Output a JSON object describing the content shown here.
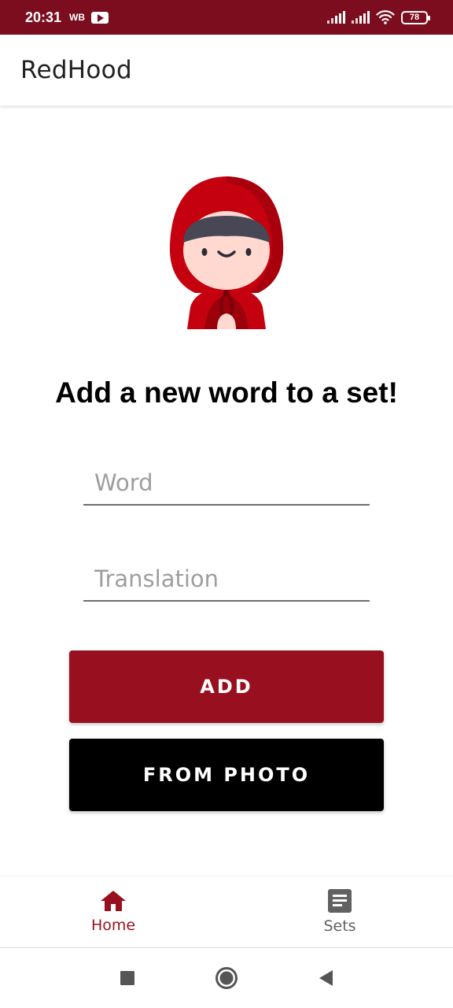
{
  "status_bar": {
    "time": "20:31",
    "carrier_badge": "WB",
    "battery": "78",
    "icons": [
      "youtube-icon",
      "signal-icon",
      "signal-icon",
      "wifi-icon",
      "battery-icon"
    ]
  },
  "app_bar": {
    "title": "RedHood"
  },
  "main": {
    "mascot_icon": "red-riding-hood-icon",
    "headline": "Add a new word to a set!",
    "word_field": {
      "placeholder": "Word",
      "value": ""
    },
    "translation_field": {
      "placeholder": "Translation",
      "value": ""
    },
    "add_button": "ADD",
    "photo_button": "FROM PHOTO"
  },
  "bottom_nav": {
    "items": [
      {
        "label": "Home",
        "icon": "home-icon",
        "active": true
      },
      {
        "label": "Sets",
        "icon": "list-icon",
        "active": false
      }
    ]
  },
  "system_nav": {
    "icons": [
      "recents-icon",
      "home-circle-icon",
      "back-icon"
    ]
  },
  "colors": {
    "status_bar": "#7b0d1e",
    "accent": "#98101f",
    "photo_button": "#000000",
    "inactive": "#616161"
  }
}
